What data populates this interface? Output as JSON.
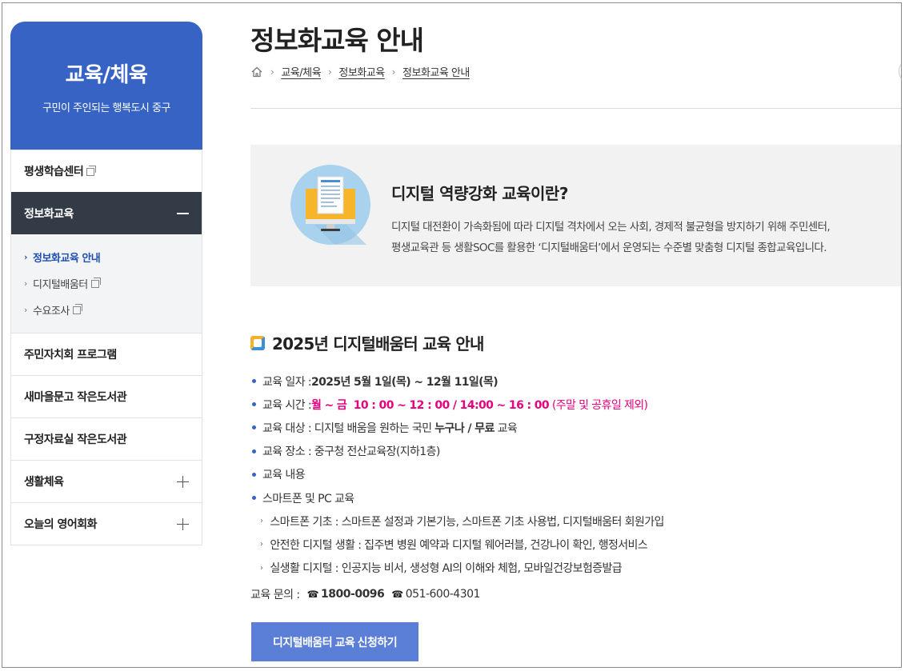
{
  "sidebar": {
    "title": "교육/체육",
    "subtitle": "구민이 주인되는 행복도시 중구",
    "items": [
      {
        "label": "평생학습센터"
      },
      {
        "label": "정보화교육"
      },
      {
        "label": "주민자치회 프로그램"
      },
      {
        "label": "새마을문고 작은도서관"
      },
      {
        "label": "구정자료실 작은도서관"
      },
      {
        "label": "생활체육"
      },
      {
        "label": "오늘의 영어회화"
      }
    ],
    "sub_items": [
      {
        "label": "정보화교육 안내"
      },
      {
        "label": "디지털배움터"
      },
      {
        "label": "수요조사"
      }
    ]
  },
  "header": {
    "title": "정보화교육 안내",
    "breadcrumb": [
      "교육/체육",
      "정보화교육",
      "정보화교육 안내"
    ]
  },
  "intro": {
    "title": "디지털 역량강화 교육이란?",
    "line1": "디지털 대전환이 가속화됨에 따라 디지털 격차에서 오는 사회, 경제적 불균형을 방지하기 위해 주민센터,",
    "line2": "평생교육관 등 생활SOC를 활용한 ‘디지털배움터’에서 운영되는 수준별 맞춤형 디지털 종합교육입니다."
  },
  "section": {
    "title": "2025년 디지털배움터 교육 안내",
    "date_label": "교육 일자 : ",
    "date_value": "2025년 5월 1일(목) ~ 12월 11일(목)",
    "time_label": "교육 시간 : ",
    "time_value": "월 ~ 금  10 : 00 ~ 12 : 00 / 14:00 ~ 16 : 00",
    "time_note": " (주말 및 공휴일 제외)",
    "target_label": "교육 대상 : 디지털 배움을 원하는 국민 ",
    "target_bold": "누구나 / 무료",
    "target_suffix": " 교육",
    "place": "교육 장소 : 중구청 전산교육장(지하1층)",
    "content": "교육 내용",
    "course": "스마트폰 및 PC 교육",
    "sub_courses": [
      "스마트폰 기초 : 스마트폰 설정과 기본기능, 스마트폰 기초 사용법, 디지털배움터 회원가입",
      "안전한 디지털 생활 : 집주변 병원 예약과 디지털 웨어러블, 건강나이 확인, 행정서비스",
      "실생활 디지털 : 인공지능 비서, 생성형 AI의 이해와 체험, 모바일건강보험증발급"
    ],
    "contact_label": "교육 문의 : ",
    "phone1": "1800-0096",
    "phone2": "051-600-4301",
    "apply_button": "디지털배움터 교육 신청하기"
  },
  "colors": {
    "brand": "#3763c4",
    "active_menu": "#333c46",
    "highlight": "#e4007f",
    "button": "#5b7fd6"
  }
}
